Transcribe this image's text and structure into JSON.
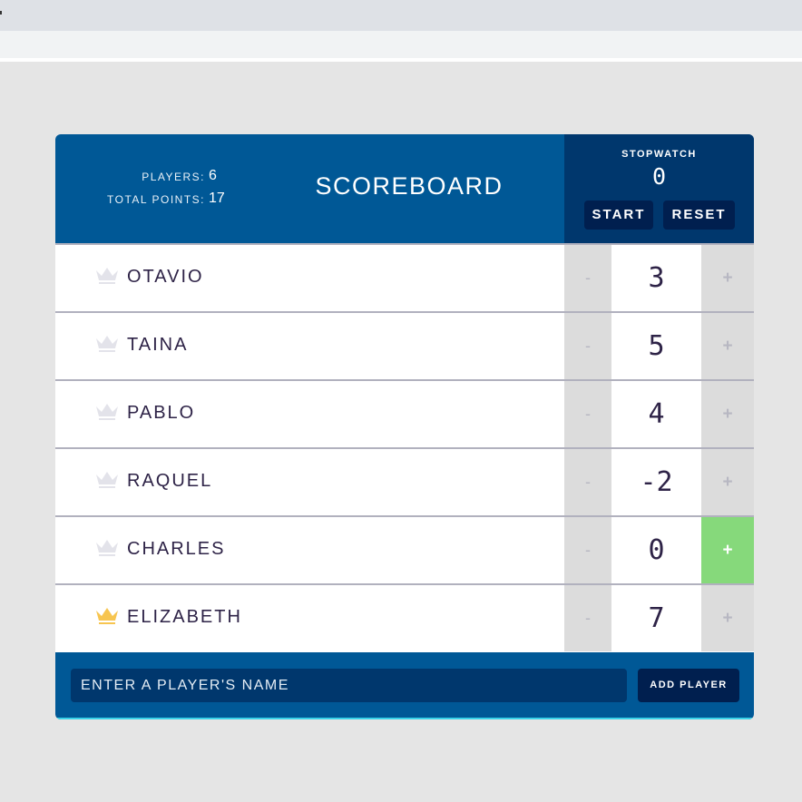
{
  "header": {
    "players_label": "PLAYERS:",
    "players_value": "6",
    "points_label": "TOTAL POINTS:",
    "points_value": "17",
    "title": "SCOREBOARD"
  },
  "stopwatch": {
    "label": "STOPWATCH",
    "time": "0",
    "start_label": "START",
    "reset_label": "RESET"
  },
  "players": [
    {
      "name": "OTAVIO",
      "score": "3",
      "leader": false
    },
    {
      "name": "TAINA",
      "score": "5",
      "leader": false
    },
    {
      "name": "PABLO",
      "score": "4",
      "leader": false
    },
    {
      "name": "RAQUEL",
      "score": "-2",
      "leader": false
    },
    {
      "name": "CHARLES",
      "score": "0",
      "leader": false
    },
    {
      "name": "ELIZABETH",
      "score": "7",
      "leader": true
    }
  ],
  "controls": {
    "decrement": "-",
    "increment": "+"
  },
  "form": {
    "placeholder": "ENTER A PLAYER'S NAME",
    "add_label": "ADD PLAYER"
  },
  "colors": {
    "header_blue": "#005896",
    "stopwatch_blue": "#00376d",
    "button_navy": "#001f4f",
    "crown_gold": "#f7c550",
    "crown_gray": "#e3e3ea",
    "increment_active": "#86d97b",
    "text_dark": "#2e2347"
  },
  "icons": {
    "crown": "crown-icon"
  }
}
